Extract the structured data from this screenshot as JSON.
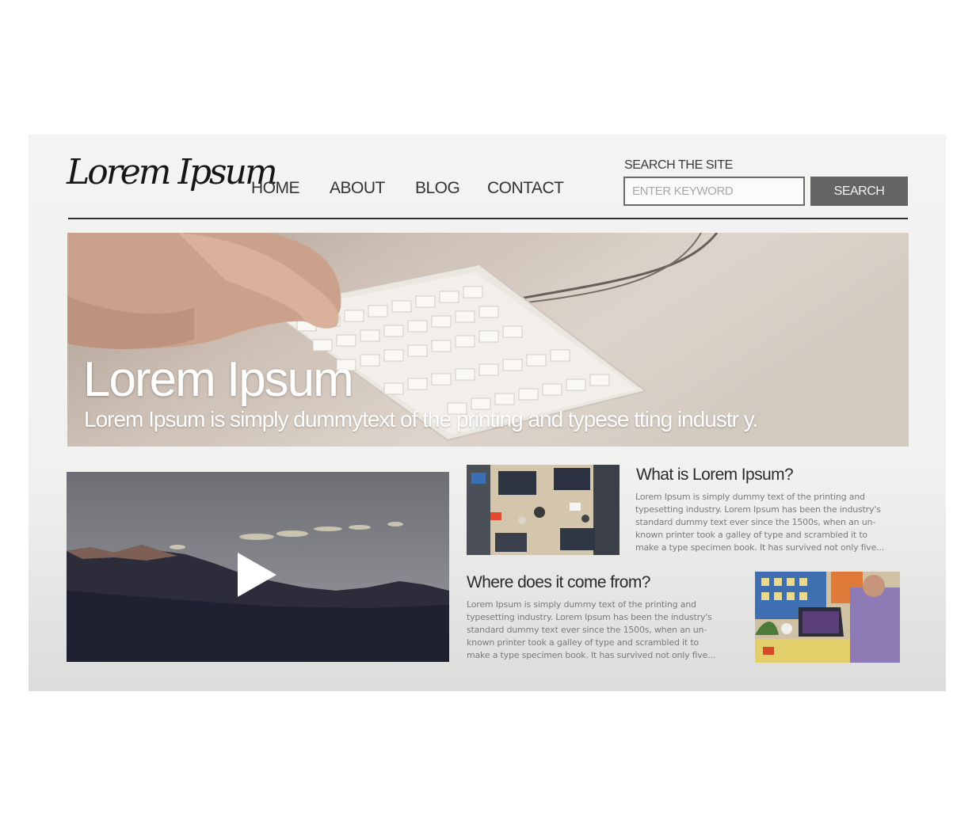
{
  "header": {
    "logo_text": "Lorem Ipsum",
    "nav": [
      {
        "label": "HOME"
      },
      {
        "label": "ABOUT"
      },
      {
        "label": "BLOG"
      },
      {
        "label": "CONTACT"
      }
    ],
    "search": {
      "label": "SEARCH THE SITE",
      "placeholder": "ENTER KEYWORD",
      "button_label": "SEARCH"
    }
  },
  "hero": {
    "title": "Lorem Ipsum",
    "subtitle": "Lorem Ipsum is simply dummytext of the printing and typese tting industr y.",
    "image": "keyboard-typing-photo"
  },
  "video": {
    "image": "mountain-landscape-photo",
    "play_icon": "play-icon"
  },
  "articles": [
    {
      "title": "What is Lorem Ipsum?",
      "lines": [
        "Lorem Ipsum is simply dummy text of the printing and",
        "typesetting industry. Lorem Ipsum has been the industry's",
        "standard dummy text ever since the 1500s, when an un-",
        "known printer took a galley of type and scrambled it to",
        "make a type specimen book. It has survived not only five..."
      ],
      "image": "team-desk-photo"
    },
    {
      "title": "Where does it come from?",
      "lines": [
        "Lorem Ipsum is simply dummy text of the printing and",
        "typesetting industry. Lorem Ipsum has been the industry's",
        "standard dummy text ever since the 1500s, when an un-",
        "known printer took a galley of type and scrambled it to",
        "make a type specimen book. It has survived not only five..."
      ],
      "image": "man-at-laptop-photo"
    }
  ],
  "colors": {
    "button": "#646464",
    "divider": "#2f2f2f",
    "page_background": "#f2f2f1"
  }
}
